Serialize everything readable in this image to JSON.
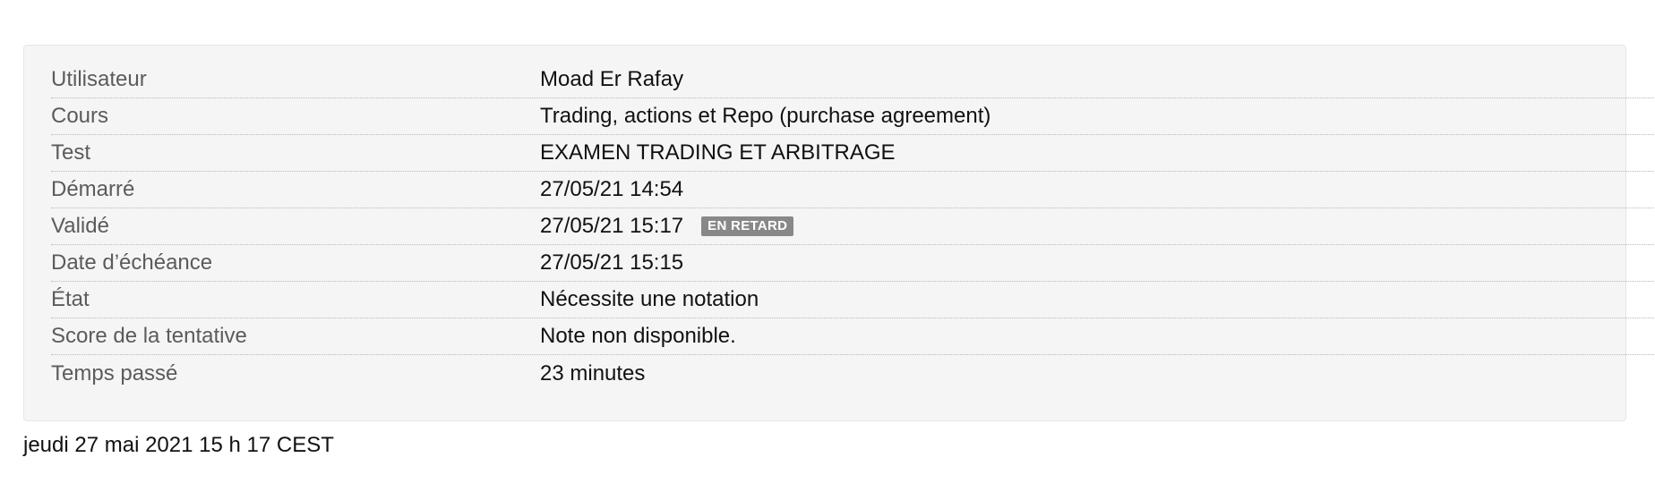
{
  "attempt_summary": {
    "rows": [
      {
        "label": "Utilisateur",
        "value": "Moad Er Rafay"
      },
      {
        "label": "Cours",
        "value": "Trading, actions et Repo (purchase agreement)"
      },
      {
        "label": "Test",
        "value": "EXAMEN TRADING ET ARBITRAGE"
      },
      {
        "label": "Démarré",
        "value": "27/05/21 14:54"
      },
      {
        "label": "Validé",
        "value": "27/05/21 15:17",
        "badge": "EN RETARD"
      },
      {
        "label": "Date d’échéance",
        "value": "27/05/21 15:15"
      },
      {
        "label": "État",
        "value": "Nécessite une notation"
      },
      {
        "label": "Score de la tentative",
        "value": "Note non disponible."
      },
      {
        "label": "Temps passé",
        "value": "23 minutes"
      }
    ]
  },
  "footer": {
    "timestamp": "jeudi 27 mai 2021 15 h 17 CEST"
  },
  "colors": {
    "panel_background": "#f5f5f5",
    "label_text": "#5b5b5b",
    "badge_background": "#888888"
  }
}
